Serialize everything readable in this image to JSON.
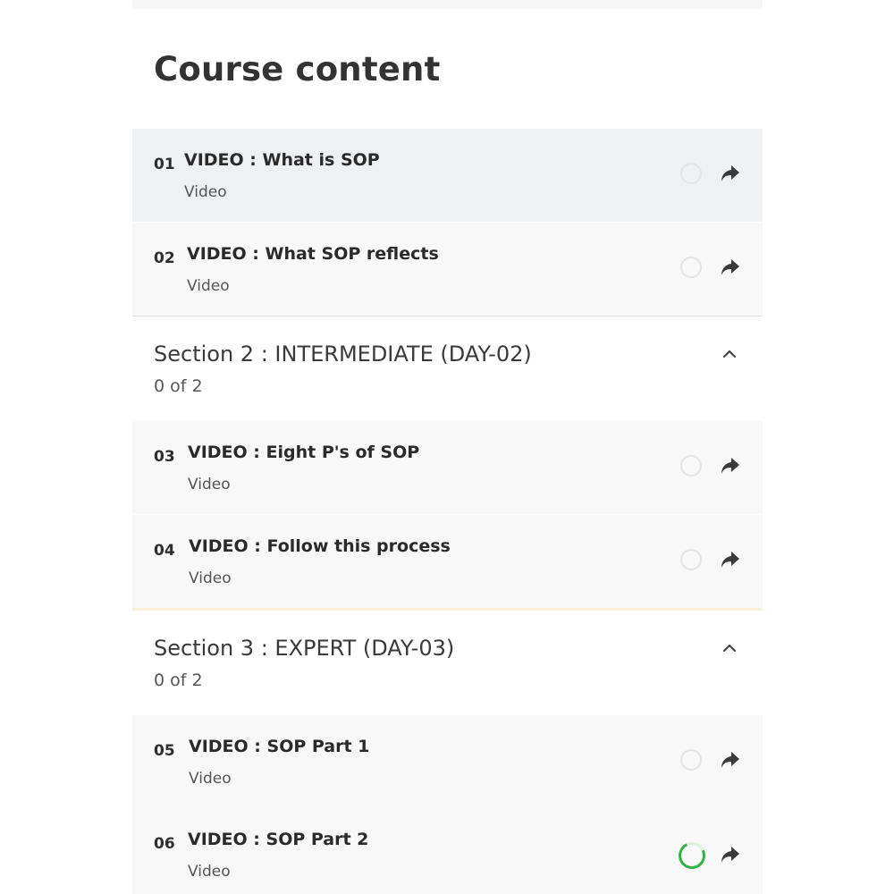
{
  "course": {
    "title": "Course content"
  },
  "lessons": [
    {
      "num": "01",
      "title": "VIDEO : What is SOP",
      "type": "Video"
    },
    {
      "num": "02",
      "title": "VIDEO : What SOP reflects",
      "type": "Video"
    },
    {
      "num": "03",
      "title": "VIDEO : Eight P's of SOP",
      "type": "Video"
    },
    {
      "num": "04",
      "title": "VIDEO : Follow this process",
      "type": "Video"
    },
    {
      "num": "05",
      "title": "VIDEO : SOP Part 1",
      "type": "Video"
    },
    {
      "num": "06",
      "title": "VIDEO : SOP Part 2",
      "type": "Video"
    }
  ],
  "sections": [
    {
      "title": "Section 2 : INTERMEDIATE (DAY-02)",
      "progress": "0 of 2"
    },
    {
      "title": "Section 3 : EXPERT (DAY-03)",
      "progress": "0 of 2"
    }
  ],
  "icons": {
    "status": "status-circle-icon",
    "share": "share-arrow-icon",
    "collapse": "chevron-up-icon"
  },
  "colors": {
    "progress_green": "#2fb344",
    "active_row": "#eef0f2"
  }
}
